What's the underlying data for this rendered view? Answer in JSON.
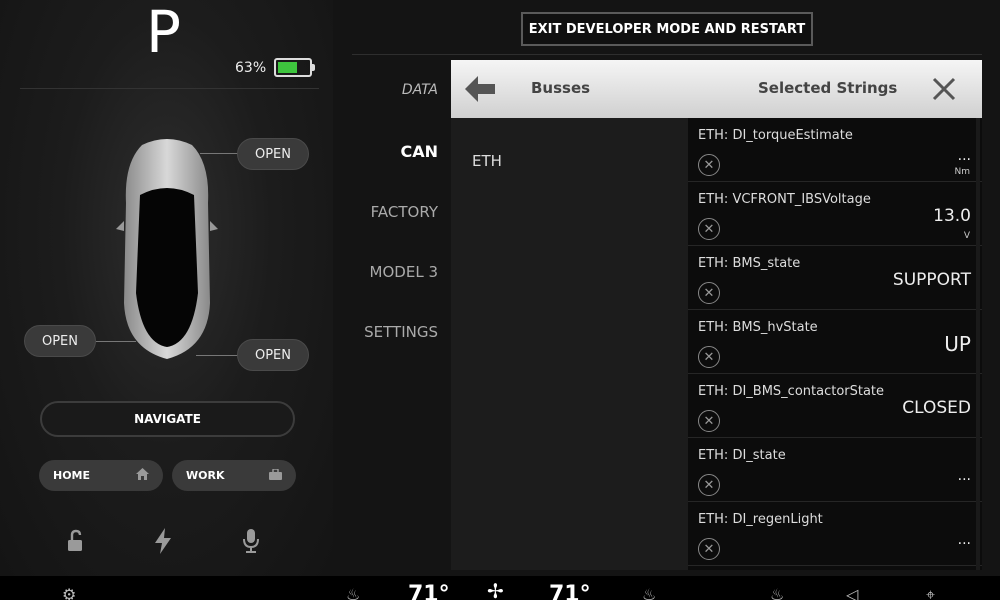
{
  "left": {
    "gear": "P",
    "battery": {
      "percent_label": "63%",
      "level": 0.63,
      "color": "#3ec53e"
    },
    "doors": {
      "front": "OPEN",
      "left": "OPEN",
      "rear": "OPEN"
    },
    "navigate_label": "NAVIGATE",
    "destinations": [
      {
        "label": "HOME",
        "icon": "home-icon"
      },
      {
        "label": "WORK",
        "icon": "briefcase-icon"
      }
    ],
    "bottom_icons": [
      "unlock-icon",
      "charge-icon",
      "microphone-icon"
    ]
  },
  "header": {
    "exit_button": "EXIT DEVELOPER MODE AND RESTART"
  },
  "nav": [
    {
      "label": "DATA"
    },
    {
      "label": "CAN"
    },
    {
      "label": "FACTORY"
    },
    {
      "label": "MODEL 3"
    },
    {
      "label": "SETTINGS"
    }
  ],
  "nav_active": "CAN",
  "panel": {
    "busses_title": "Busses",
    "selected_title": "Selected Strings",
    "busses": [
      "ETH"
    ],
    "signals": [
      {
        "name": "ETH: DI_torqueEstimate",
        "value": "...",
        "unit": "Nm"
      },
      {
        "name": "ETH: VCFRONT_IBSVoltage",
        "value": "13.0",
        "unit": "V"
      },
      {
        "name": "ETH: BMS_state",
        "value": "SUPPORT",
        "unit": ""
      },
      {
        "name": "ETH: BMS_hvState",
        "value": "UP",
        "unit": ""
      },
      {
        "name": "ETH: DI_BMS_contactorState",
        "value": "CLOSED",
        "unit": ""
      },
      {
        "name": "ETH: DI_state",
        "value": "...",
        "unit": ""
      },
      {
        "name": "ETH: DI_regenLight",
        "value": "...",
        "unit": ""
      }
    ]
  },
  "bottom_bar": {
    "temp_left": "71°",
    "temp_right": "71°"
  },
  "colors": {
    "accent": "#3ec53e",
    "panel_header": "#e6e6e6",
    "background": "#141414"
  }
}
